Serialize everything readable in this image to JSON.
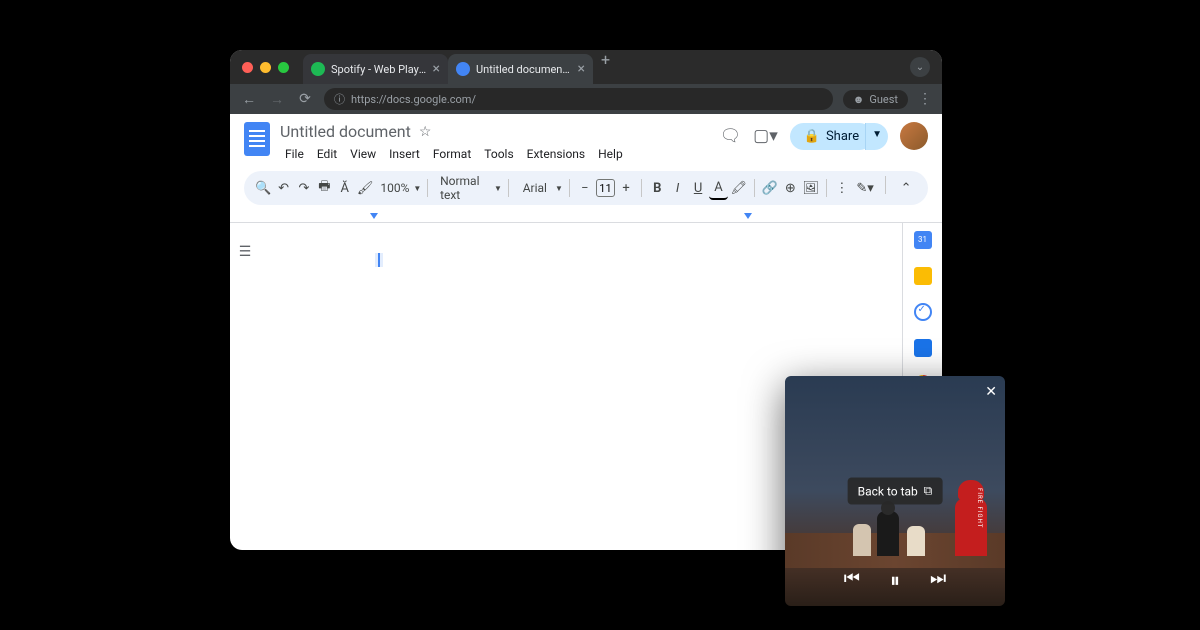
{
  "browser": {
    "tabs": [
      {
        "title": "Spotify - Web Player: Music f",
        "icon_color": "#1db954"
      },
      {
        "title": "Untitled document - Google",
        "icon_color": "#4285f4"
      }
    ],
    "url": "https://docs.google.com/",
    "guest_label": "Guest"
  },
  "docs": {
    "title": "Untitled document",
    "menus": [
      "File",
      "Edit",
      "View",
      "Insert",
      "Format",
      "Tools",
      "Extensions",
      "Help"
    ],
    "share_label": "Share",
    "toolbar": {
      "zoom": "100%",
      "style": "Normal text",
      "font": "Arial",
      "size": "11"
    }
  },
  "pip": {
    "back_label": "Back to tab",
    "jacket_text": "FIRE FIGHT"
  }
}
